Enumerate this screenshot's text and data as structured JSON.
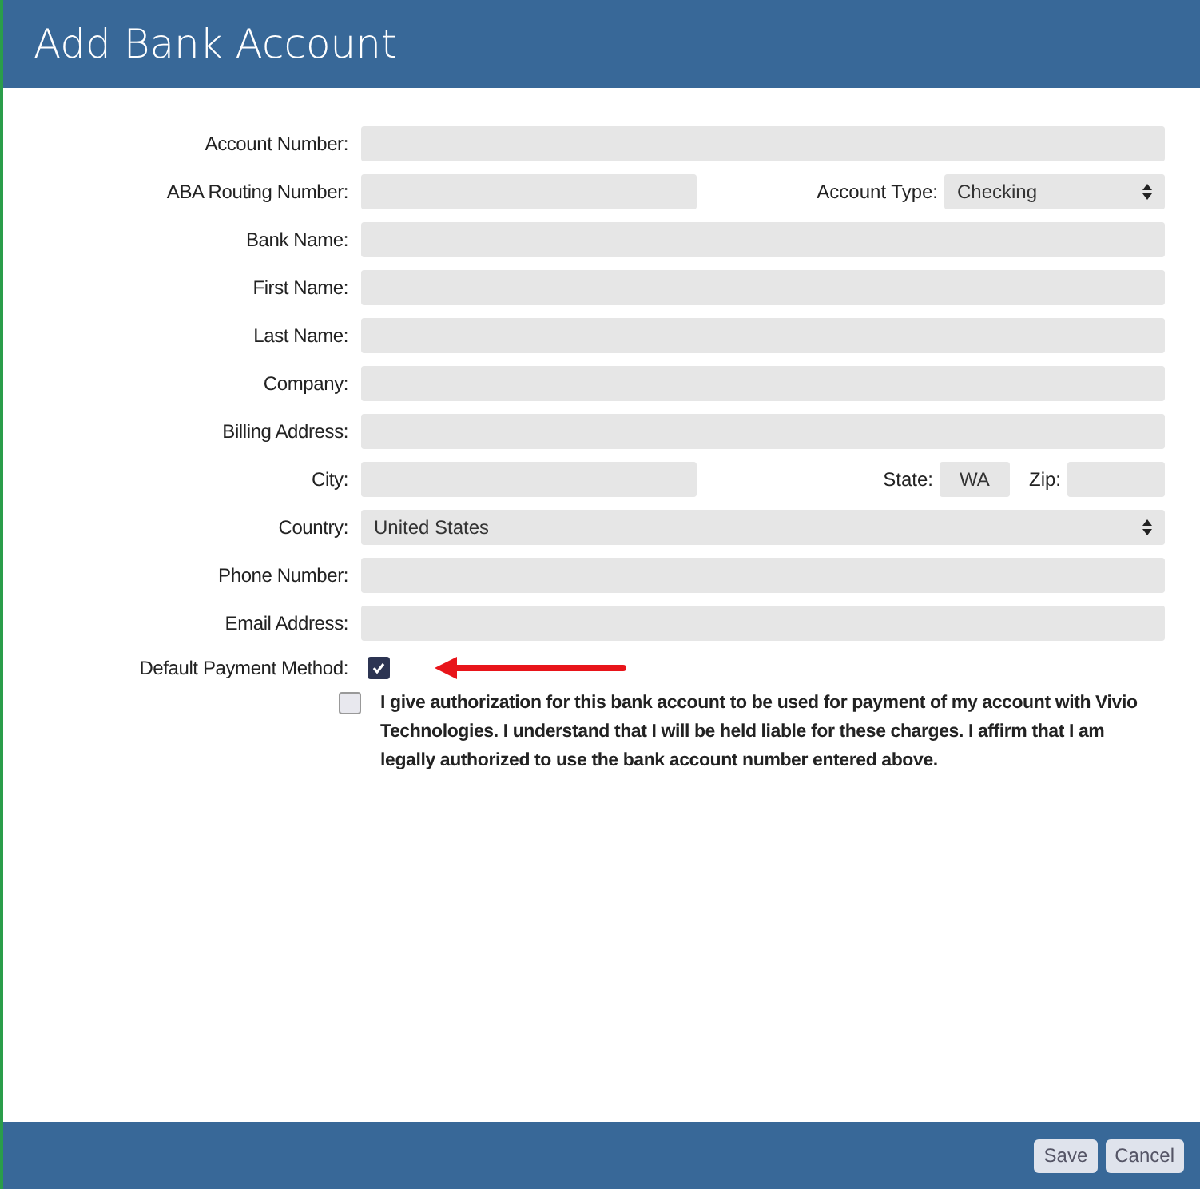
{
  "window": {
    "title": "Add Bank Account"
  },
  "rows": [
    {
      "label": "Account Number:",
      "fields": [
        {
          "kind": "text"
        }
      ]
    },
    {
      "label": "ABA Routing Number:",
      "fields": [
        {
          "kind": "text"
        },
        {
          "kind": "select",
          "label": "Account Type:",
          "value": "Checking"
        }
      ]
    },
    {
      "label": "Bank Name:",
      "fields": [
        {
          "kind": "text"
        }
      ]
    },
    {
      "label": "First Name:",
      "fields": [
        {
          "kind": "text"
        }
      ]
    },
    {
      "label": "Last Name:",
      "fields": [
        {
          "kind": "text"
        }
      ]
    },
    {
      "label": "Company:",
      "fields": [
        {
          "kind": "text"
        }
      ]
    },
    {
      "label": "Billing Address:",
      "fields": [
        {
          "kind": "text"
        }
      ]
    },
    {
      "label": "City:",
      "fields": [
        {
          "kind": "text"
        },
        {
          "kind": "text",
          "label": "State:",
          "value": "WA"
        },
        {
          "kind": "text",
          "label": "Zip:"
        }
      ]
    },
    {
      "label": "Country:",
      "fields": [
        {
          "kind": "select",
          "value": "United States"
        }
      ]
    },
    {
      "label": "Phone Number:",
      "fields": [
        {
          "kind": "text"
        }
      ]
    },
    {
      "label": "Email Address:",
      "fields": [
        {
          "kind": "text"
        }
      ]
    }
  ],
  "default_payment": {
    "label": "Default Payment Method:",
    "checked": true
  },
  "authorization": {
    "checked": false,
    "text": "I give authorization for this bank account to be used for payment of my account with Vivio Technologies. I understand that I will be held liable for these charges. I affirm that I am legally authorized to use the bank account number entered above."
  },
  "buttons": [
    "Save",
    "Cancel"
  ]
}
